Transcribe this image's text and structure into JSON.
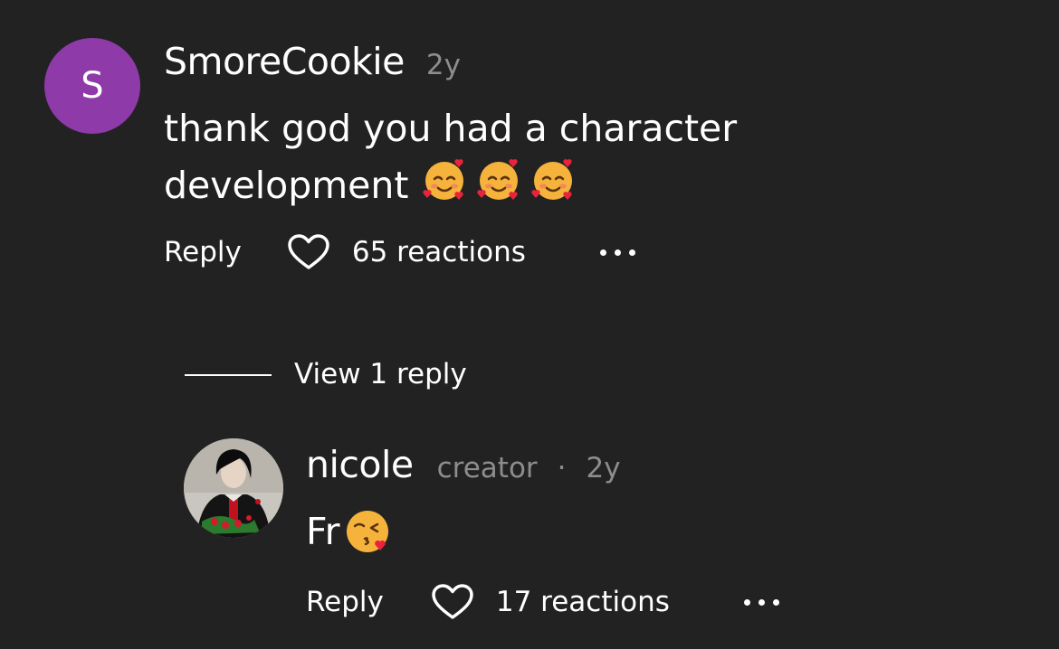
{
  "comment": {
    "avatar_letter": "S",
    "avatar_color": "#8e3aa8",
    "username": "SmoreCookie",
    "age": "2y",
    "text": "thank god you had a character development",
    "emoji": [
      "smiling-face-with-hearts",
      "smiling-face-with-hearts",
      "smiling-face-with-hearts"
    ],
    "reply_label": "Reply",
    "reactions_label": "65 reactions"
  },
  "thread": {
    "view_replies_label": "View 1 reply"
  },
  "reply": {
    "username": "nicole",
    "badge": "creator",
    "separator": "·",
    "age": "2y",
    "text": "Fr",
    "emoji": "face-blowing-a-kiss",
    "reply_label": "Reply",
    "reactions_label": "17 reactions"
  },
  "colors": {
    "background": "#222222",
    "text": "#ffffff",
    "muted": "#8d8d8d"
  }
}
